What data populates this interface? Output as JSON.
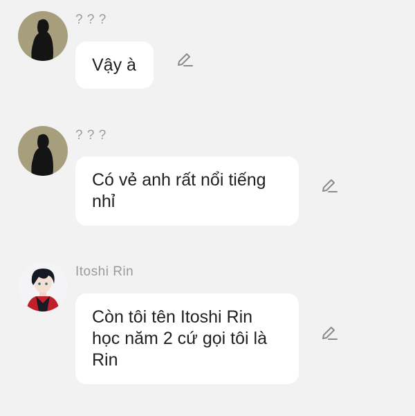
{
  "messages": [
    {
      "sender": "? ? ?",
      "avatar_icon": "silhouette-avatar",
      "text": "Vậy à"
    },
    {
      "sender": "? ? ?",
      "avatar_icon": "silhouette-avatar",
      "text": "Có vẻ anh rất nổi tiếng nhỉ"
    },
    {
      "sender": "Itoshi Rin",
      "avatar_icon": "anime-boy-avatar",
      "text": "Còn tôi tên Itoshi Rin học năm 2 cứ gọi tôi là Rin"
    }
  ],
  "edit_icon": "pencil-icon",
  "colors": {
    "background": "#f2f2f2",
    "bubble": "#ffffff",
    "sender_text": "#9a9a9a",
    "message_text": "#1f1f1f",
    "silhouette_bg": "#a79e7e"
  }
}
